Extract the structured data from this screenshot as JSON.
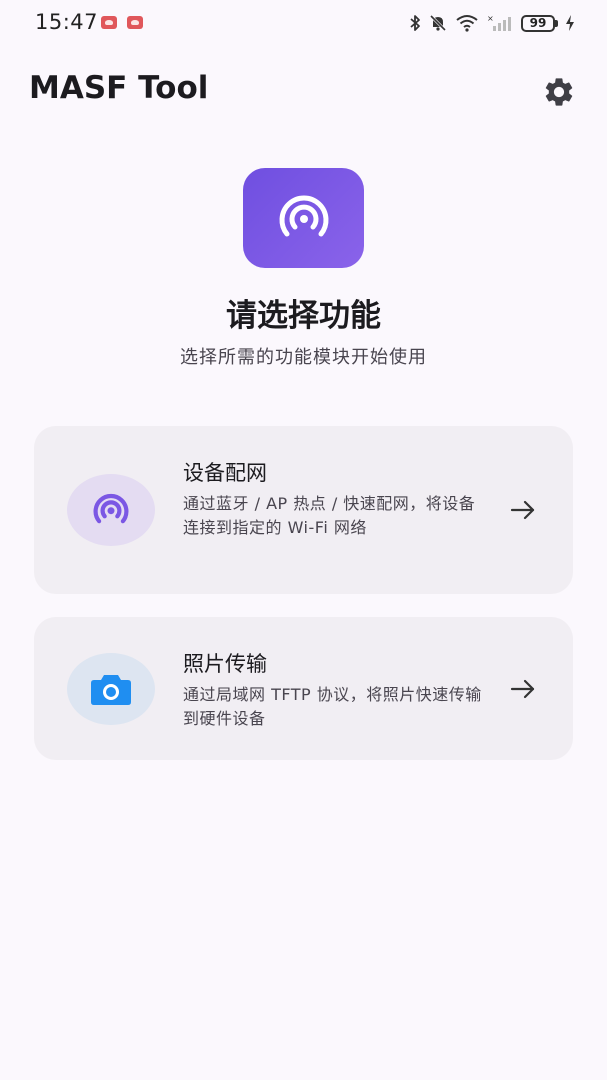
{
  "status_bar": {
    "time": "15:47",
    "battery": "99",
    "icons": [
      "notification-app-icon",
      "notification-app-icon",
      "bluetooth-icon",
      "bell-off-icon",
      "wifi-icon",
      "signal-icon",
      "battery-icon",
      "charging-icon"
    ]
  },
  "header": {
    "title": "MASF Tool",
    "settings_icon": "gear-icon"
  },
  "hero": {
    "icon": "wireless-signal-icon",
    "title": "请选择功能",
    "subtitle": "选择所需的功能模块开始使用"
  },
  "cards": [
    {
      "title": "设备配网",
      "description": "通过蓝牙 / AP 热点 / 快速配网，将设备连接到指定的 Wi-Fi 网络",
      "icon": "wireless-signal-icon"
    },
    {
      "title": "照片传输",
      "description": "通过局域网 TFTP 协议，将照片快速传输到硬件设备",
      "icon": "camera-icon"
    }
  ],
  "colors": {
    "background": "#fbf8fd",
    "accent": "#7b57e4",
    "card_background": "#f1eef3",
    "camera_blue": "#1f8ef1"
  }
}
